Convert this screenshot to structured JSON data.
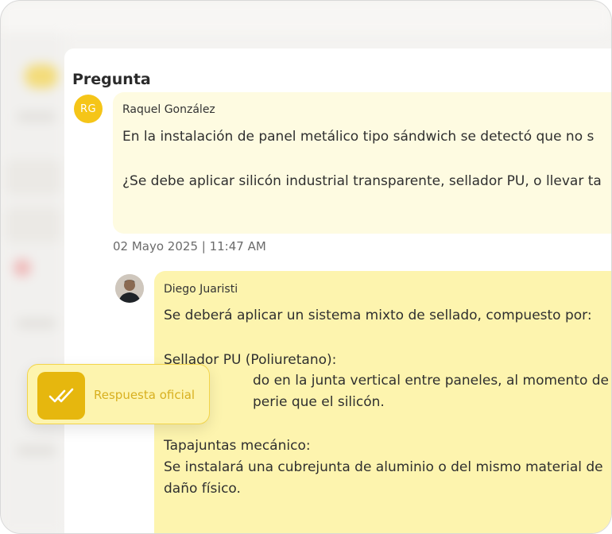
{
  "section_title": "Pregunta",
  "question": {
    "avatar_initials": "RG",
    "author": "Raquel González",
    "line1": "En la instalación de panel metálico tipo sándwich se detectó que no s",
    "line2": "¿Se debe aplicar silicón industrial transparente, sellador PU, o llevar ta",
    "date": "02 Mayo 2025 | 11:47 AM"
  },
  "answer": {
    "author": "Diego Juaristi",
    "line1": "Se deberá aplicar un sistema mixto de sellado, compuesto por:",
    "line2": "Sellador PU (Poliuretano):",
    "line3": "do en la junta vertical entre paneles, al momento de la ins",
    "line4": "perie que el silicón.",
    "line5": "Tapajuntas mecánico:",
    "line6": "Se instalará una cubrejunta de aluminio o del mismo material de",
    "line7": "daño físico."
  },
  "badge": {
    "label": "Respuesta oficial",
    "icon": "double-check-icon"
  },
  "colors": {
    "accent": "#f5c518",
    "question_bubble": "#fefbe1",
    "answer_bubble": "#fdf4ae",
    "badge_icon_bg": "#e6b70e"
  }
}
